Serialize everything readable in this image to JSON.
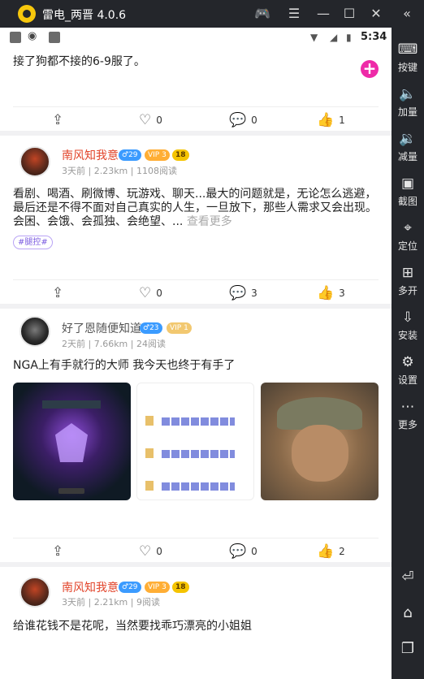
{
  "window": {
    "title": "雷电_两晋 4.0.6"
  },
  "status": {
    "time": "5:34"
  },
  "toolbar": [
    {
      "label": "按键",
      "icon": "keyboard-icon"
    },
    {
      "label": "加量",
      "icon": "volume-up-icon"
    },
    {
      "label": "减量",
      "icon": "volume-down-icon"
    },
    {
      "label": "截图",
      "icon": "screenshot-icon"
    },
    {
      "label": "定位",
      "icon": "location-icon"
    },
    {
      "label": "多开",
      "icon": "multi-instance-icon"
    },
    {
      "label": "安装",
      "icon": "install-icon"
    },
    {
      "label": "设置",
      "icon": "gear-icon"
    },
    {
      "label": "更多",
      "icon": "more-icon"
    }
  ],
  "posts": [
    {
      "text": "接了狗都不接的6-9服了。",
      "share": "",
      "likes": "0",
      "comments": "0",
      "thumbs": "1"
    },
    {
      "username": "南风知我意",
      "gender_badge": "♂29",
      "vip": "VIP 3",
      "level": "18",
      "meta": "3天前 | 2.23km | 1108阅读",
      "text_lines": [
        "看剧、喝酒、刷微博、玩游戏、聊天...最大的问题就是，无论怎么逃避，",
        "最后还是不得不面对自己真实的人生，一旦放下，那些人需求又会出现。",
        "会困、会饿、会孤独、会绝望、..."
      ],
      "read_more": "查看更多",
      "tag": "#腿控#",
      "likes": "0",
      "comments": "3",
      "thumbs": "3"
    },
    {
      "username": "好了恩随便知道",
      "gender_badge": "♂23",
      "vip": "VIP 1",
      "meta": "2天前 | 7.66km | 24阅读",
      "text": "NGA上有手就行的大师 我今天也终于有手了",
      "likes": "0",
      "comments": "0",
      "thumbs": "2"
    },
    {
      "username": "南风知我意",
      "gender_badge": "♂29",
      "vip": "VIP 3",
      "level": "18",
      "meta": "3天前 | 2.21km | 9阅读",
      "text": "给谁花钱不是花呢，当然要找乖巧漂亮的小姐姐"
    }
  ]
}
